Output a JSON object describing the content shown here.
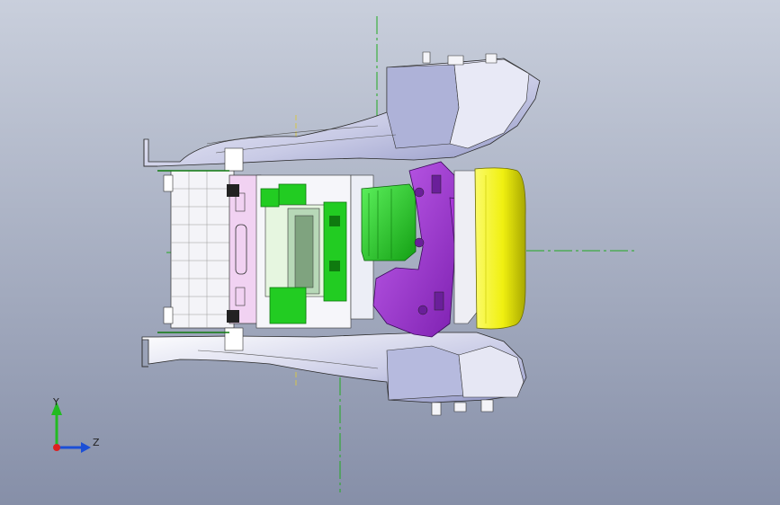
{
  "viewport": {
    "background_top": "#c9cfdc",
    "background_bottom": "#868fa8"
  },
  "model": {
    "part_colors": {
      "shell": "#dcdff0",
      "shell_shade": "#a7abcf",
      "purple": "#a838d8",
      "purple_dark": "#6a1f9a",
      "green": "#22cc22",
      "green_dark": "#0f7a0f",
      "yellow": "#f0f010",
      "yellow_dark": "#b5b500",
      "frame": "#f2f2f6",
      "pink": "#f1d2f2",
      "outline": "#2a2a2a"
    },
    "centerline_color": "#22aa22",
    "centerline_color_alt": "#d6c64a"
  },
  "triad": {
    "y_label": "Y",
    "z_label": "Z",
    "y_color": "#22bb22",
    "z_color": "#1c4fd6",
    "x_color": "#dd2020"
  }
}
